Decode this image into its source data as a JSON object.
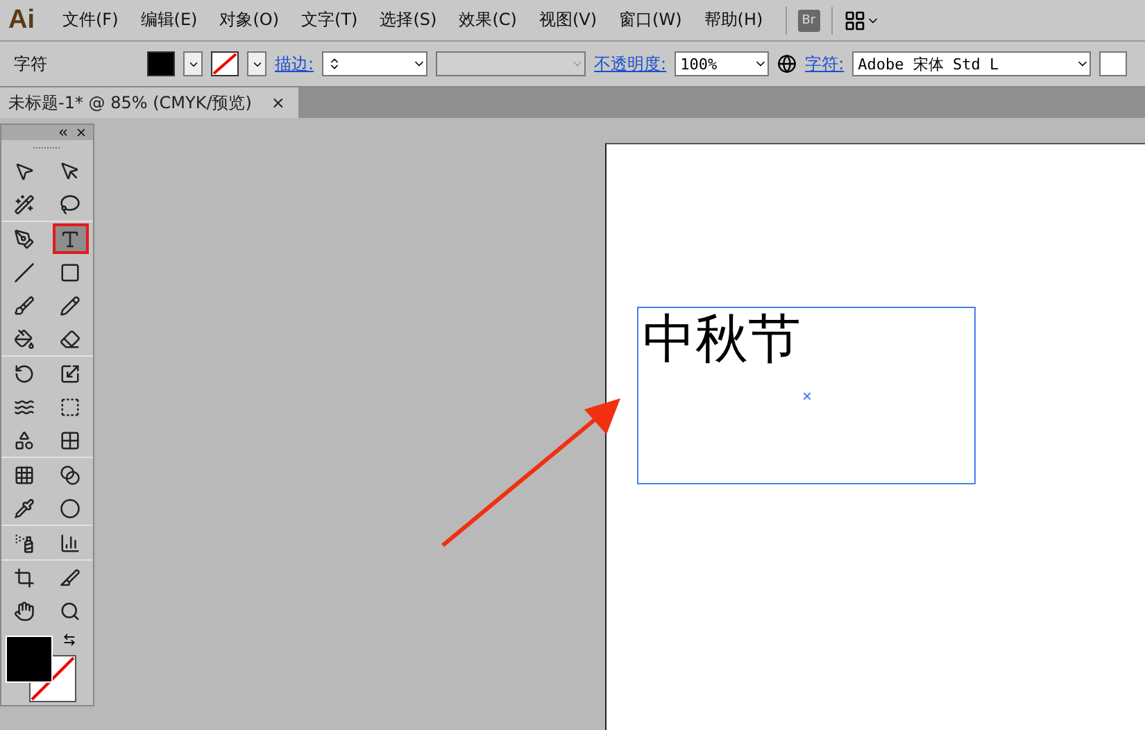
{
  "app_logo": "Ai",
  "menu": [
    "文件(F)",
    "编辑(E)",
    "对象(O)",
    "文字(T)",
    "选择(S)",
    "效果(C)",
    "视图(V)",
    "窗口(W)",
    "帮助(H)"
  ],
  "bridge_button": "Br",
  "control_bar": {
    "label": "字符",
    "stroke_link": "描边:",
    "opacity_link": "不透明度:",
    "opacity_value": "100%",
    "font_link": "字符:",
    "font_value": "Adobe 宋体 Std L"
  },
  "document_tab": {
    "title": "未标题-1* @ 85% (CMYK/预览)",
    "close": "×"
  },
  "tools": [
    {
      "pair": [
        {
          "selected": false
        },
        {
          "selected": false
        }
      ]
    },
    {
      "pair": [
        {
          "selected": false
        },
        {
          "selected": false
        }
      ]
    },
    {
      "pair": [
        {
          "selected": false
        },
        {
          "selected": true
        }
      ]
    },
    {
      "pair": [
        {
          "selected": false
        },
        {
          "selected": false
        }
      ]
    },
    {
      "pair": [
        {
          "selected": false
        },
        {
          "selected": false
        }
      ]
    },
    {
      "pair": [
        {
          "selected": false
        },
        {
          "selected": false
        }
      ]
    },
    {
      "pair": [
        {
          "selected": false
        },
        {
          "selected": false
        }
      ]
    },
    {
      "pair": [
        {
          "selected": false
        },
        {
          "selected": false
        }
      ]
    },
    {
      "pair": [
        {
          "selected": false
        },
        {
          "selected": false
        }
      ]
    },
    {
      "pair": [
        {
          "selected": false
        },
        {
          "selected": false
        }
      ]
    },
    {
      "pair": [
        {
          "selected": false
        },
        {
          "selected": false
        }
      ]
    },
    {
      "pair": [
        {
          "selected": false
        },
        {
          "selected": false
        }
      ]
    },
    {
      "pair": [
        {
          "selected": false
        },
        {
          "selected": false
        }
      ]
    },
    {
      "pair": [
        {
          "selected": false
        },
        {
          "selected": false
        }
      ]
    }
  ],
  "artboard_text": "中秋节"
}
